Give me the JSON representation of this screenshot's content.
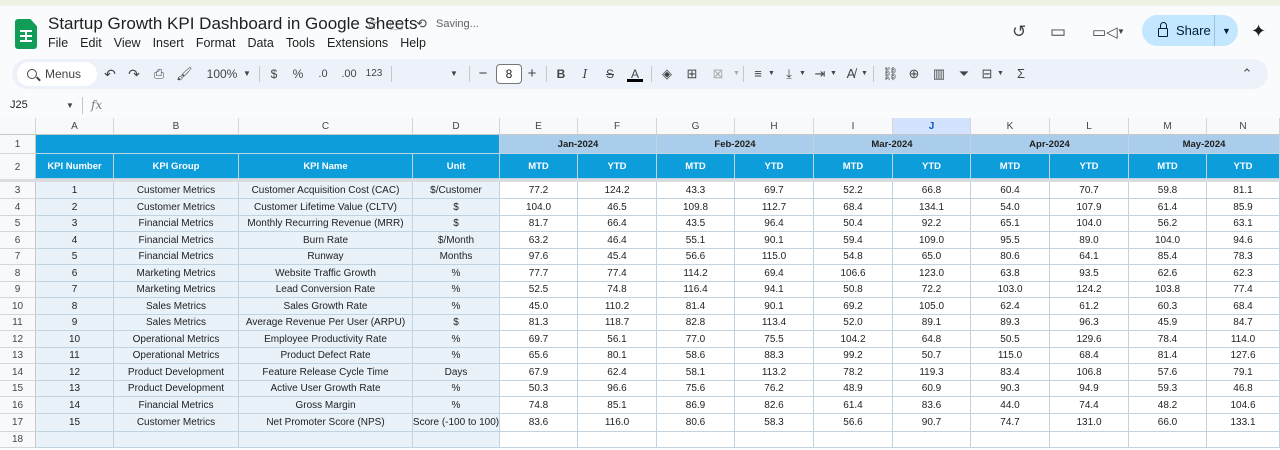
{
  "doc": {
    "title": "Startup Growth KPI Dashboard in Google Sheets",
    "status": "Saving...",
    "share_label": "Share"
  },
  "menu": [
    "File",
    "Edit",
    "View",
    "Insert",
    "Format",
    "Data",
    "Tools",
    "Extensions",
    "Help"
  ],
  "toolbar": {
    "search_label": "Menus",
    "zoom": "100%",
    "currency": "$",
    "percent": "%",
    "dec_dec": ".0",
    "inc_dec": ".00",
    "number_format": "123",
    "font_size": "8"
  },
  "name_box": "J25",
  "fx_label": "fx",
  "colors": {
    "header_dark": "#0d9ddb",
    "header_light": "#a9cdea",
    "row_blue": "#e9f1f9",
    "text_white": "#ffffff",
    "share_bg": "#c2e7ff",
    "sheets_green": "#0f9d58"
  },
  "icons": [
    "sheets-logo-icon",
    "star-icon",
    "move-folder-icon",
    "sync-icon",
    "history-icon",
    "comment-icon",
    "video-call-icon",
    "lock-icon",
    "gemini-spark-icon",
    "search-icon",
    "undo-icon",
    "redo-icon",
    "print-icon",
    "paint-format-icon",
    "bold-icon",
    "italic-icon",
    "strikethrough-icon",
    "text-color-icon",
    "fill-color-icon",
    "borders-icon",
    "merge-icon",
    "align-icon",
    "valign-icon",
    "wrap-icon",
    "rotate-icon",
    "link-icon",
    "insert-comment-icon",
    "insert-chart-icon",
    "filter-icon",
    "views-icon",
    "functions-icon",
    "collapse-icon"
  ],
  "columns": [
    "A",
    "B",
    "C",
    "D",
    "E",
    "F",
    "G",
    "H",
    "I",
    "J",
    "K",
    "L",
    "M",
    "N"
  ],
  "header": {
    "months": [
      "Jan-2024",
      "Feb-2024",
      "Mar-2024",
      "Apr-2024",
      "May-2024"
    ],
    "labels": [
      "KPI Number",
      "KPI Group",
      "KPI Name",
      "Unit"
    ],
    "mtd": "MTD",
    "ytd": "YTD"
  },
  "rows": [
    {
      "n": "1",
      "group": "Customer Metrics",
      "name": "Customer Acquisition Cost (CAC)",
      "unit": "$/Customer",
      "vals": [
        "77.2",
        "124.2",
        "43.3",
        "69.7",
        "52.2",
        "66.8",
        "60.4",
        "70.7",
        "59.8",
        "81.1"
      ]
    },
    {
      "n": "2",
      "group": "Customer Metrics",
      "name": "Customer Lifetime Value (CLTV)",
      "unit": "$",
      "vals": [
        "104.0",
        "46.5",
        "109.8",
        "112.7",
        "68.4",
        "134.1",
        "54.0",
        "107.9",
        "61.4",
        "85.9"
      ]
    },
    {
      "n": "3",
      "group": "Financial Metrics",
      "name": "Monthly Recurring Revenue (MRR)",
      "unit": "$",
      "vals": [
        "81.7",
        "66.4",
        "43.5",
        "96.4",
        "50.4",
        "92.2",
        "65.1",
        "104.0",
        "56.2",
        "63.1"
      ]
    },
    {
      "n": "4",
      "group": "Financial Metrics",
      "name": "Burn Rate",
      "unit": "$/Month",
      "vals": [
        "63.2",
        "46.4",
        "55.1",
        "90.1",
        "59.4",
        "109.0",
        "95.5",
        "89.0",
        "104.0",
        "94.6"
      ]
    },
    {
      "n": "5",
      "group": "Financial Metrics",
      "name": "Runway",
      "unit": "Months",
      "vals": [
        "97.6",
        "45.4",
        "56.6",
        "115.0",
        "54.8",
        "65.0",
        "80.6",
        "64.1",
        "85.4",
        "78.3"
      ]
    },
    {
      "n": "6",
      "group": "Marketing Metrics",
      "name": "Website Traffic Growth",
      "unit": "%",
      "vals": [
        "77.7",
        "77.4",
        "114.2",
        "69.4",
        "106.6",
        "123.0",
        "63.8",
        "93.5",
        "62.6",
        "62.3"
      ]
    },
    {
      "n": "7",
      "group": "Marketing Metrics",
      "name": "Lead Conversion Rate",
      "unit": "%",
      "vals": [
        "52.5",
        "74.8",
        "116.4",
        "94.1",
        "50.8",
        "72.2",
        "103.0",
        "124.2",
        "103.8",
        "77.4"
      ]
    },
    {
      "n": "8",
      "group": "Sales Metrics",
      "name": "Sales Growth Rate",
      "unit": "%",
      "vals": [
        "45.0",
        "110.2",
        "81.4",
        "90.1",
        "69.2",
        "105.0",
        "62.4",
        "61.2",
        "60.3",
        "68.4"
      ]
    },
    {
      "n": "9",
      "group": "Sales Metrics",
      "name": "Average Revenue Per User (ARPU)",
      "unit": "$",
      "vals": [
        "81.3",
        "118.7",
        "82.8",
        "113.4",
        "52.0",
        "89.1",
        "89.3",
        "96.3",
        "45.9",
        "84.7"
      ]
    },
    {
      "n": "10",
      "group": "Operational Metrics",
      "name": "Employee Productivity Rate",
      "unit": "%",
      "vals": [
        "69.7",
        "56.1",
        "77.0",
        "75.5",
        "104.2",
        "64.8",
        "50.5",
        "129.6",
        "78.4",
        "114.0"
      ]
    },
    {
      "n": "11",
      "group": "Operational Metrics",
      "name": "Product Defect Rate",
      "unit": "%",
      "vals": [
        "65.6",
        "80.1",
        "58.6",
        "88.3",
        "99.2",
        "50.7",
        "115.0",
        "68.4",
        "81.4",
        "127.6"
      ]
    },
    {
      "n": "12",
      "group": "Product Development",
      "name": "Feature Release Cycle Time",
      "unit": "Days",
      "vals": [
        "67.9",
        "62.4",
        "58.1",
        "113.2",
        "78.2",
        "119.3",
        "83.4",
        "106.8",
        "57.6",
        "79.1"
      ]
    },
    {
      "n": "13",
      "group": "Product Development",
      "name": "Active User Growth Rate",
      "unit": "%",
      "vals": [
        "50.3",
        "96.6",
        "75.6",
        "76.2",
        "48.9",
        "60.9",
        "90.3",
        "94.9",
        "59.3",
        "46.8"
      ]
    },
    {
      "n": "14",
      "group": "Financial Metrics",
      "name": "Gross Margin",
      "unit": "%",
      "vals": [
        "74.8",
        "85.1",
        "86.9",
        "82.6",
        "61.4",
        "83.6",
        "44.0",
        "74.4",
        "48.2",
        "104.6"
      ]
    },
    {
      "n": "15",
      "group": "Customer Metrics",
      "name": "Net Promoter Score (NPS)",
      "unit": "Score (-100 to 100)",
      "vals": [
        "83.6",
        "116.0",
        "80.6",
        "58.3",
        "56.6",
        "90.7",
        "74.7",
        "131.0",
        "66.0",
        "133.1"
      ]
    }
  ],
  "row_numbers": [
    "1",
    "2",
    "3",
    "4",
    "5",
    "6",
    "7",
    "8",
    "9",
    "10",
    "11",
    "12",
    "13",
    "14",
    "15",
    "16",
    "17",
    "18"
  ]
}
